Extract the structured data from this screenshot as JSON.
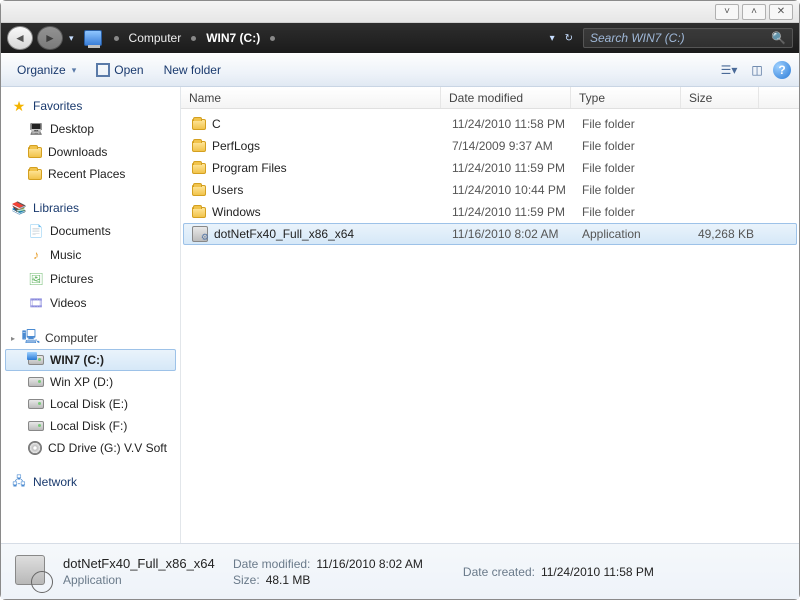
{
  "titlebar": {
    "min": "˅",
    "max": "˄",
    "close": "✕"
  },
  "nav": {
    "crumb1": "Computer",
    "crumb2": "WIN7 (C:)",
    "search_placeholder": "Search WIN7 (C:)"
  },
  "toolbar": {
    "organize": "Organize",
    "open": "Open",
    "new_folder": "New folder"
  },
  "sidebar": {
    "favorites": "Favorites",
    "fav_items": [
      "Desktop",
      "Downloads",
      "Recent Places"
    ],
    "libraries": "Libraries",
    "lib_items": [
      "Documents",
      "Music",
      "Pictures",
      "Videos"
    ],
    "computer": "Computer",
    "drives": [
      "WIN7 (C:)",
      "Win XP (D:)",
      "Local Disk (E:)",
      "Local Disk (F:)",
      "CD Drive (G:) V.V Soft"
    ],
    "network": "Network"
  },
  "columns": {
    "name": "Name",
    "date": "Date modified",
    "type": "Type",
    "size": "Size"
  },
  "rows": [
    {
      "name": "C",
      "date": "11/24/2010 11:58 PM",
      "type": "File folder",
      "size": "",
      "icon": "folder"
    },
    {
      "name": "PerfLogs",
      "date": "7/14/2009 9:37 AM",
      "type": "File folder",
      "size": "",
      "icon": "folder"
    },
    {
      "name": "Program Files",
      "date": "11/24/2010 11:59 PM",
      "type": "File folder",
      "size": "",
      "icon": "folder"
    },
    {
      "name": "Users",
      "date": "11/24/2010 10:44 PM",
      "type": "File folder",
      "size": "",
      "icon": "folder"
    },
    {
      "name": "Windows",
      "date": "11/24/2010 11:59 PM",
      "type": "File folder",
      "size": "",
      "icon": "folder"
    },
    {
      "name": "dotNetFx40_Full_x86_x64",
      "date": "11/16/2010 8:02 AM",
      "type": "Application",
      "size": "49,268 KB",
      "icon": "app",
      "selected": true
    }
  ],
  "details": {
    "title": "dotNetFx40_Full_x86_x64",
    "subtitle": "Application",
    "dm_label": "Date modified:",
    "dm_val": "11/16/2010 8:02 AM",
    "sz_label": "Size:",
    "sz_val": "48.1 MB",
    "dc_label": "Date created:",
    "dc_val": "11/24/2010 11:58 PM"
  }
}
